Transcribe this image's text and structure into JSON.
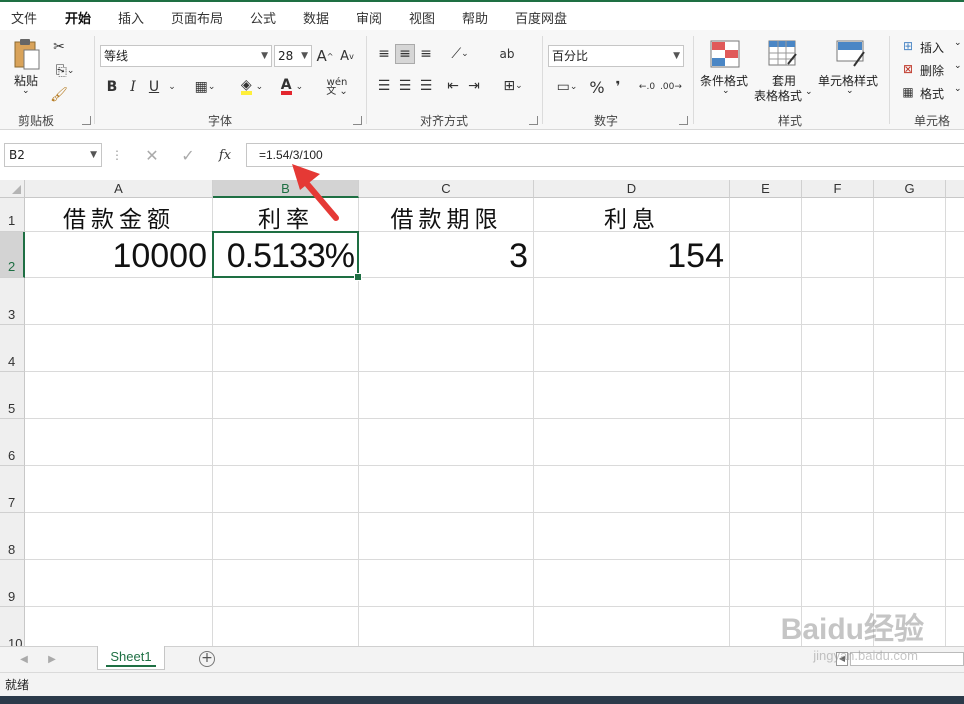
{
  "ribbon_tabs": [
    "文件",
    "开始",
    "插入",
    "页面布局",
    "公式",
    "数据",
    "审阅",
    "视图",
    "帮助",
    "百度网盘"
  ],
  "active_tab": "开始",
  "clipboard": {
    "paste_label": "粘贴",
    "group_label": "剪贴板"
  },
  "font": {
    "name": "等线",
    "size": "28",
    "bold_label": "B",
    "italic_label": "I",
    "underline_label": "U",
    "font_color_label": "A",
    "pinyin_label": "wén",
    "group_label": "字体"
  },
  "alignment": {
    "group_label": "对齐方式",
    "wrap_label": "ab"
  },
  "number": {
    "format": "百分比",
    "percent_label": "%",
    "comma_label": "❜",
    "group_label": "数字"
  },
  "styles": {
    "conditional_label": "条件格式",
    "table_label_1": "套用",
    "table_label_2": "表格格式",
    "cell_styles_label": "单元格样式",
    "group_label": "样式"
  },
  "cells": {
    "insert_label": "插入",
    "delete_label": "删除",
    "format_label": "格式",
    "group_label": "单元格"
  },
  "formula_bar": {
    "name_box": "B2",
    "formula": "=1.54/3/100",
    "fx_label": "fx"
  },
  "columns": [
    "A",
    "B",
    "C",
    "D",
    "E",
    "F",
    "G"
  ],
  "selected_column": "B",
  "rows": [
    "1",
    "2",
    "3",
    "4",
    "5",
    "6",
    "7",
    "8",
    "9",
    "10"
  ],
  "selected_row": "2",
  "data_headers": [
    "借款金额",
    "利率",
    "借款期限",
    "利息"
  ],
  "data_values": [
    "10000",
    "0.5133%",
    "3",
    "154"
  ],
  "sheet_tab": "Sheet1",
  "status_text": "就绪",
  "watermark": {
    "main": "Baidu经验",
    "sub": "jingyan.baidu.com"
  },
  "accent_color": "#1e6f43",
  "arrow_color": "#e53935"
}
